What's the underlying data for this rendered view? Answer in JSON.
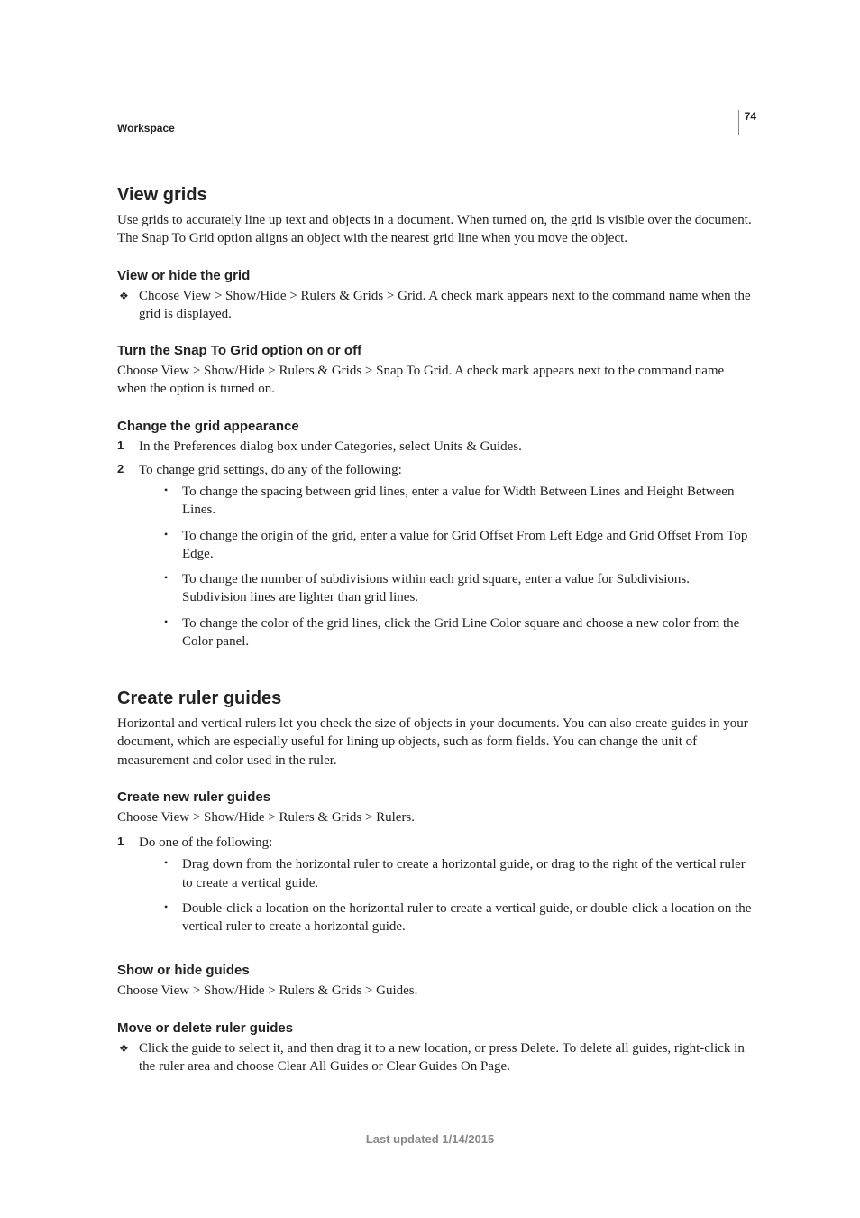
{
  "header": {
    "breadcrumb": "Workspace",
    "page_number": "74"
  },
  "s1": {
    "title": "View grids",
    "intro": "Use grids to accurately line up text and objects in a document. When turned on, the grid is visible over the document. The Snap To Grid option aligns an object with the nearest grid line when you move the object.",
    "sub1": {
      "title": "View or hide the grid",
      "item": "Choose View > Show/Hide > Rulers & Grids > Grid. A check mark appears next to the command name when the grid is displayed."
    },
    "sub2": {
      "title": "Turn the Snap To Grid option on or off",
      "body": "Choose View > Show/Hide > Rulers & Grids > Snap To Grid. A check mark appears next to the command name when the option is turned on."
    },
    "sub3": {
      "title": "Change the grid appearance",
      "step1": "In the Preferences dialog box under Categories, select Units & Guides.",
      "step2": "To change grid settings, do any of the following:",
      "b1": "To change the spacing between grid lines, enter a value for Width Between Lines and Height Between Lines.",
      "b2": "To change the origin of the grid, enter a value for Grid Offset From Left Edge and Grid Offset From Top Edge.",
      "b3": "To change the number of subdivisions within each grid square, enter a value for Subdivisions. Subdivision lines are lighter than grid lines.",
      "b4": "To change the color of the grid lines, click the Grid Line Color square and choose a new color from the Color panel."
    }
  },
  "s2": {
    "title": "Create ruler guides",
    "intro": "Horizontal and vertical rulers let you check the size of objects in your documents. You can also create guides in your document, which are especially useful for lining up objects, such as form fields. You can change the unit of measurement and color used in the ruler.",
    "sub1": {
      "title": "Create new ruler guides",
      "body": "Choose View > Show/Hide > Rulers & Grids > Rulers.",
      "step1": "Do one of the following:",
      "b1": "Drag down from the horizontal ruler to create a horizontal guide, or drag to the right of the vertical ruler to create a vertical guide.",
      "b2": "Double-click a location on the horizontal ruler to create a vertical guide, or double-click a location on the vertical ruler to create a horizontal guide."
    },
    "sub2": {
      "title": "Show or hide guides",
      "body": "Choose View > Show/Hide > Rulers & Grids > Guides."
    },
    "sub3": {
      "title": "Move or delete ruler guides",
      "item": "Click the guide to select it, and then drag it to a new location, or press Delete. To delete all guides, right-click in the ruler area and choose Clear All Guides or Clear Guides On Page."
    }
  },
  "footer": {
    "updated": "Last updated 1/14/2015"
  }
}
